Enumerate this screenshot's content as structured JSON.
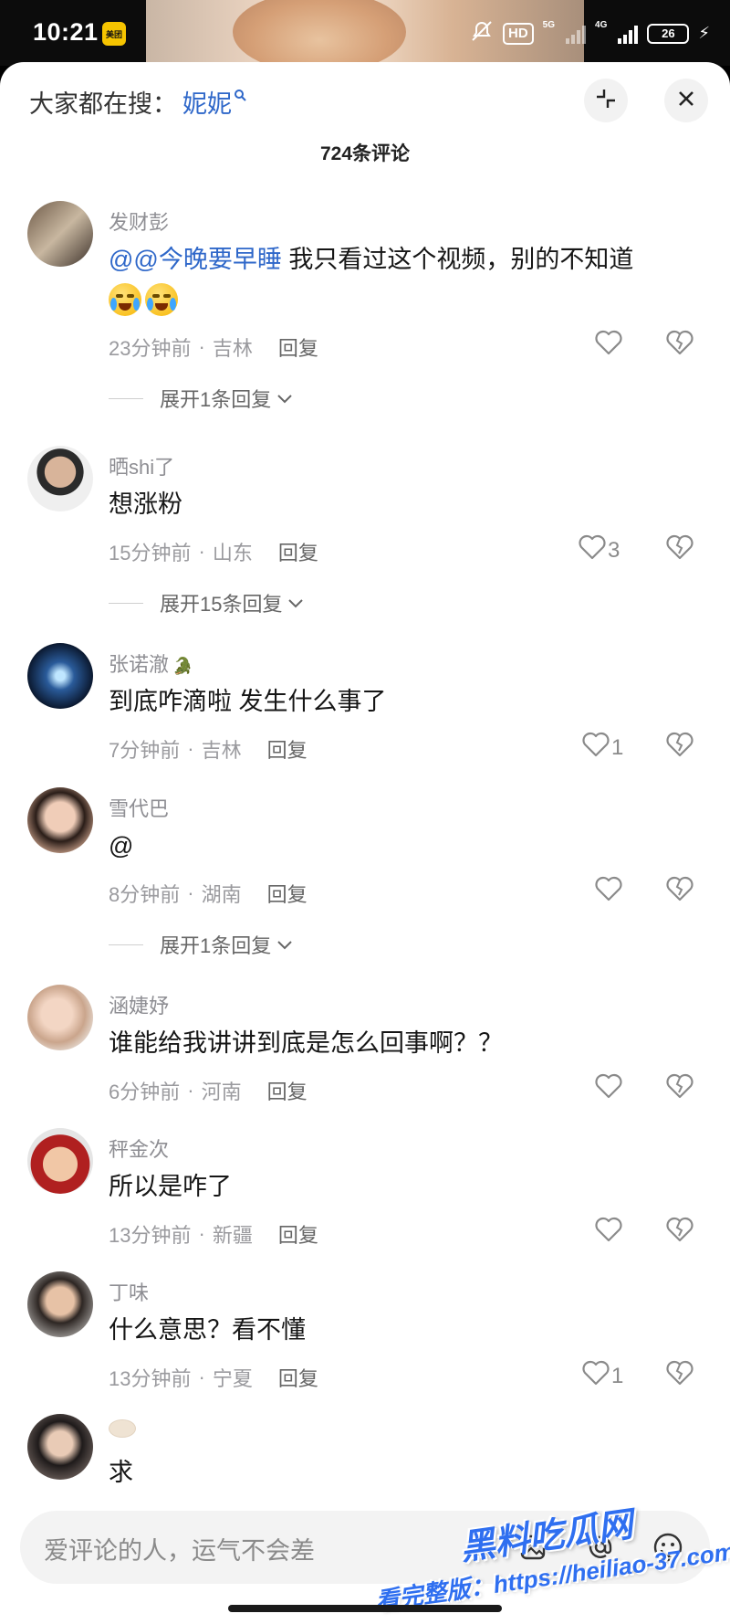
{
  "status_bar": {
    "time": "10:21",
    "app_badge": "美团",
    "hd": "HD",
    "net1": "5G",
    "net2": "4G",
    "battery": "26"
  },
  "header": {
    "search_prefix": "大家都在搜：",
    "search_keyword": "妮妮",
    "comment_count": "724条评论"
  },
  "comments": [
    {
      "user": "发财彭",
      "mention": "@@今晚要早睡",
      "text": "我只看过这个视频，别的不知道",
      "time": "23分钟前",
      "location": "吉林",
      "reply": "回复",
      "likes": "",
      "expand": "展开1条回复"
    },
    {
      "user": "晒shi了",
      "text": "想涨粉",
      "time": "15分钟前",
      "location": "山东",
      "reply": "回复",
      "likes": "3",
      "expand": "展开15条回复"
    },
    {
      "user": "张诺澈",
      "text": "到底咋滴啦 发生什么事了",
      "time": "7分钟前",
      "location": "吉林",
      "reply": "回复",
      "likes": "1"
    },
    {
      "user": "雪代巴",
      "text": "@",
      "time": "8分钟前",
      "location": "湖南",
      "reply": "回复",
      "likes": "",
      "expand": "展开1条回复"
    },
    {
      "user": "涵婕妤",
      "text": "谁能给我讲讲到底是怎么回事啊？？",
      "time": "6分钟前",
      "location": "河南",
      "reply": "回复",
      "likes": ""
    },
    {
      "user": "秤金次",
      "text": "所以是咋了",
      "time": "13分钟前",
      "location": "新疆",
      "reply": "回复",
      "likes": ""
    },
    {
      "user": "丁味",
      "text": "什么意思？看不懂",
      "time": "13分钟前",
      "location": "宁夏",
      "reply": "回复",
      "likes": "1"
    },
    {
      "user": "",
      "text": "求"
    }
  ],
  "input": {
    "placeholder": "爱评论的人，运气不会差"
  },
  "watermark": {
    "title": "黑料吃瓜网",
    "url": "看完整版：https://heiliao-37.com"
  },
  "icons": {
    "collapse": "collapse-icon",
    "close": "close-icon",
    "like": "heart-icon",
    "dislike": "broken-heart-icon",
    "image": "image-icon",
    "at": "at-icon",
    "emoji": "emoji-icon"
  }
}
